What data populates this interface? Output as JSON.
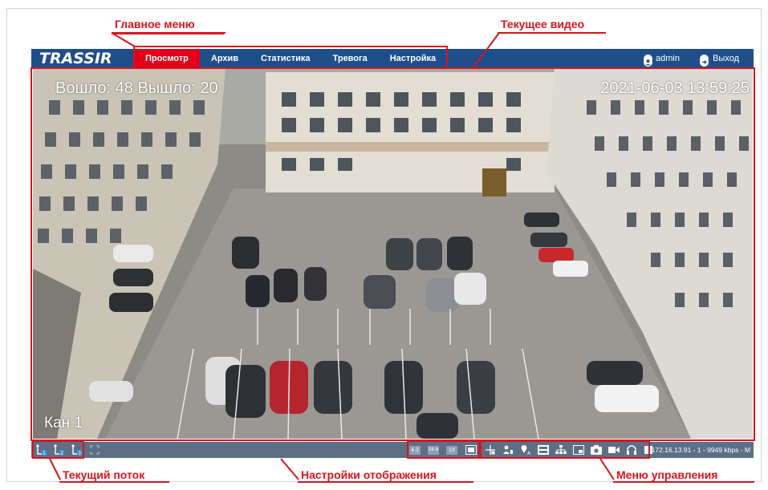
{
  "annotations": {
    "main_menu": "Главное меню",
    "current_video": "Текущее видео",
    "current_stream": "Текущий поток",
    "display_settings": "Настройки отображения",
    "control_menu": "Меню управления"
  },
  "navbar": {
    "logo": "TRASSIR",
    "menu": [
      {
        "label": "Просмотр",
        "active": true
      },
      {
        "label": "Архив",
        "active": false
      },
      {
        "label": "Статистика",
        "active": false
      },
      {
        "label": "Тревога",
        "active": false
      },
      {
        "label": "Настройка",
        "active": false
      }
    ],
    "user": "admin",
    "logout": "Выход"
  },
  "video": {
    "counter": "Вошло: 48  Вышло: 20",
    "timestamp": "2021-06-03 13:59:25",
    "channel": "Кан 1"
  },
  "toolbar": {
    "stream_buttons": [
      "stream-1-icon",
      "stream-2-icon",
      "stream-3-icon"
    ],
    "aspect_buttons": [
      "4:3",
      "16:9",
      "1X"
    ],
    "status": "172.16.13.91 - 1 - 9949 kbps - M"
  },
  "colors": {
    "navbar": "#1f4f8a",
    "active_menu": "#e3001b",
    "toolbar": "#5d6f85",
    "annotation": "#d9141e"
  }
}
